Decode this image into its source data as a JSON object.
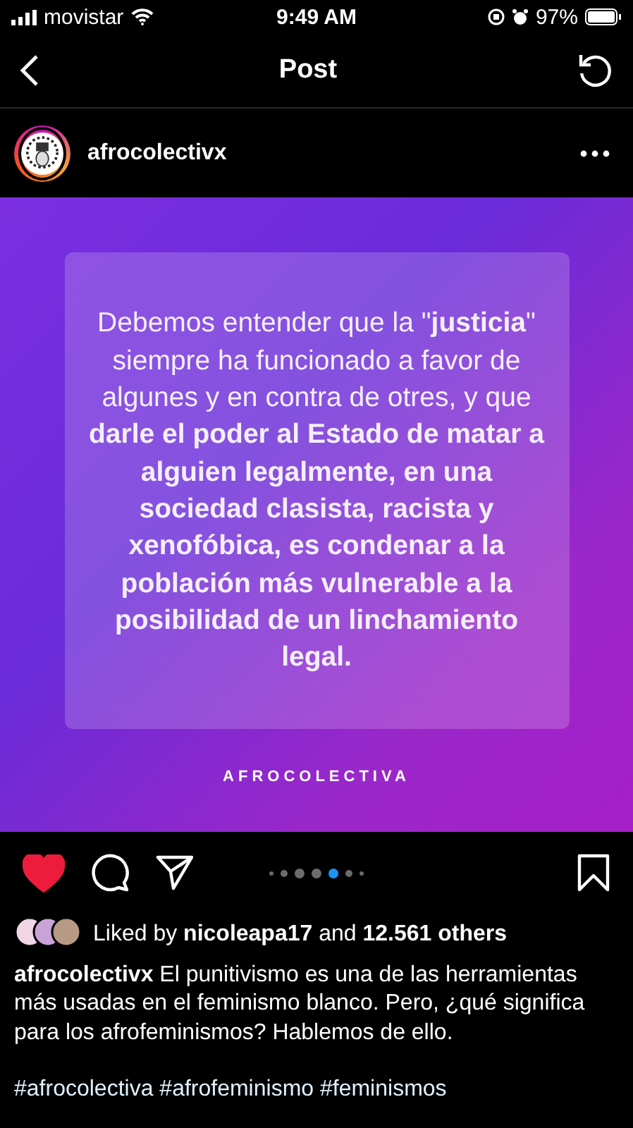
{
  "status_bar": {
    "carrier": "movistar",
    "time": "9:49 AM",
    "battery": "97%"
  },
  "nav": {
    "title": "Post"
  },
  "account": {
    "username": "afrocolectivx"
  },
  "post": {
    "quote": "Debemos entender que la \"**justicia**\" siempre ha funcionado a favor de algunes y en contra de otres, y que **darle el poder al Estado de matar a alguien legalmente, en una sociedad clasista, racista y xenofóbica, es condenar a la población más vulnerable a la posibilidad de un linchamiento legal.**",
    "brand": "AFROCOLECTIVA"
  },
  "actions": {
    "liked": true,
    "saved": false
  },
  "carousel_dots": [
    {
      "selected": false
    },
    {
      "selected": false
    },
    {
      "selected": false
    },
    {
      "selected": false
    },
    {
      "selected": true
    },
    {
      "selected": false
    },
    {
      "selected": false
    }
  ],
  "likes": "Liked by **nicoleapa17** and **12.561 others**",
  "caption": {
    "username": "afrocolectivx",
    "text": "El punitivismo es una de las herramientas más usadas en el feminismo blanco. Pero, ¿qué significa para los afrofeminismos? Hablemos de ello."
  },
  "hashtags": "#afrocolectiva #afrofeminismo #feminismos"
}
